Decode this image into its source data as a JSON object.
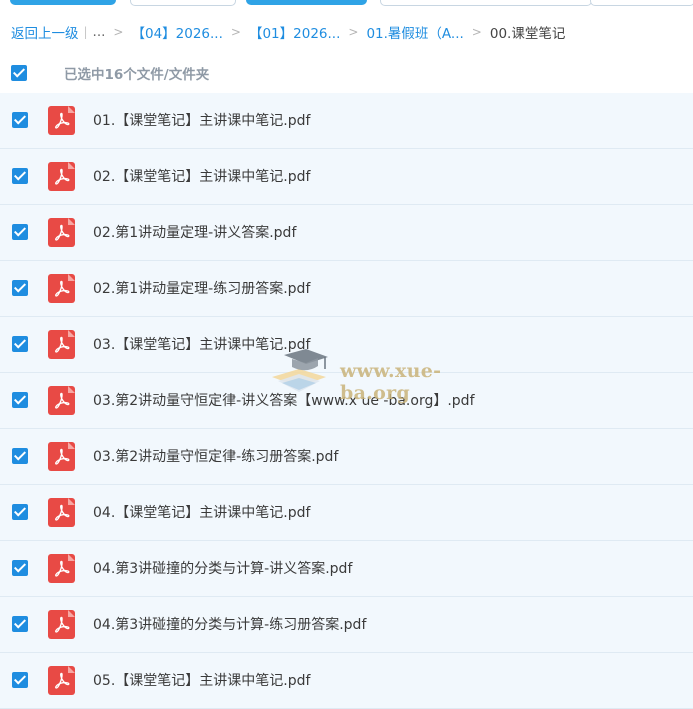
{
  "breadcrumb": {
    "back_label": "返回上一级",
    "ellipsis": "...",
    "items": [
      "【04】2026...",
      "【01】2026...",
      "01.暑假班（A..."
    ],
    "current": "00.课堂笔记"
  },
  "selection": {
    "summary": "已选中16个文件/文件夹",
    "all_checked": true
  },
  "files": [
    {
      "name": "01.【课堂笔记】主讲课中笔记.pdf",
      "checked": true,
      "icon": "pdf-icon"
    },
    {
      "name": "02.【课堂笔记】主讲课中笔记.pdf",
      "checked": true,
      "icon": "pdf-icon"
    },
    {
      "name": "02.第1讲动量定理-讲义答案.pdf",
      "checked": true,
      "icon": "pdf-icon"
    },
    {
      "name": "02.第1讲动量定理-练习册答案.pdf",
      "checked": true,
      "icon": "pdf-icon"
    },
    {
      "name": "03.【课堂笔记】主讲课中笔记.pdf",
      "checked": true,
      "icon": "pdf-icon"
    },
    {
      "name": "03.第2讲动量守恒定律-讲义答案【www.x ue -ba.org】.pdf",
      "checked": true,
      "icon": "pdf-icon"
    },
    {
      "name": "03.第2讲动量守恒定律-练习册答案.pdf",
      "checked": true,
      "icon": "pdf-icon"
    },
    {
      "name": "04.【课堂笔记】主讲课中笔记.pdf",
      "checked": true,
      "icon": "pdf-icon"
    },
    {
      "name": "04.第3讲碰撞的分类与计算-讲义答案.pdf",
      "checked": true,
      "icon": "pdf-icon"
    },
    {
      "name": "04.第3讲碰撞的分类与计算-练习册答案.pdf",
      "checked": true,
      "icon": "pdf-icon"
    },
    {
      "name": "05.【课堂笔记】主讲课中笔记.pdf",
      "checked": true,
      "icon": "pdf-icon"
    }
  ],
  "watermark": {
    "text": "www.xue-ba.org"
  },
  "colors": {
    "accent": "#1f8de0",
    "pdf": "#e84a45",
    "row_bg": "#f2f8fd"
  }
}
